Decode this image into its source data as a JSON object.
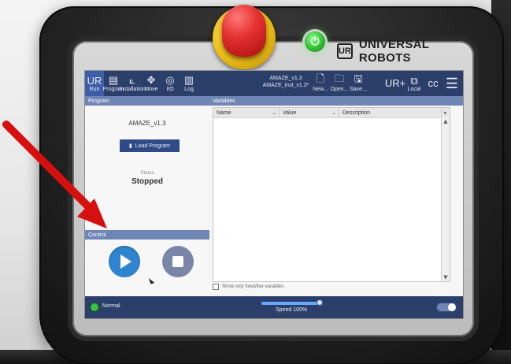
{
  "hardware": {
    "brand": {
      "logo": "UR",
      "name": "UNIVERSAL ROBOTS"
    },
    "power_symbol": "⏻"
  },
  "screen": {
    "topbar": {
      "tabs": [
        {
          "key": "run",
          "label": "Run",
          "icon": "ur-logo-icon"
        },
        {
          "key": "program",
          "label": "Program",
          "icon": "program-icon"
        },
        {
          "key": "installation",
          "label": "Installation",
          "icon": "installation-icon"
        },
        {
          "key": "move",
          "label": "Move",
          "icon": "move-icon"
        },
        {
          "key": "io",
          "label": "I/O",
          "icon": "io-icon"
        },
        {
          "key": "log",
          "label": "Log",
          "icon": "log-icon"
        }
      ],
      "file": {
        "program_file": "AMAZE_v1.3",
        "installation_file": "AMAZE_inst_v1.3*"
      },
      "file_actions": [
        {
          "key": "new",
          "label": "New..."
        },
        {
          "key": "open",
          "label": "Open..."
        },
        {
          "key": "save",
          "label": "Save..."
        }
      ],
      "right_tools": [
        {
          "key": "ur-plus",
          "label": "",
          "icon": "ur-plus-icon"
        },
        {
          "key": "local",
          "label": "Local",
          "icon": "local-icon"
        },
        {
          "key": "cc",
          "label": "",
          "icon": "cc-icon"
        }
      ]
    },
    "left_panel": {
      "header": "Program",
      "program_name": "AMAZE_v1.3",
      "load_button": "Load Program",
      "status_label": "Status",
      "status_value": "Stopped"
    },
    "control_panel": {
      "header": "Control"
    },
    "variables_panel": {
      "header": "Variables",
      "columns": {
        "name": "Name",
        "value": "Value",
        "description": "Description"
      },
      "show_fixed_label": "Show only fixed/live variables"
    },
    "footer": {
      "status": "Normal",
      "speed_label": "Speed 100%",
      "speed_percent": 100
    }
  },
  "colors": {
    "topbar": "#2b3f6a",
    "accent_blue": "#2f84cf",
    "ok_green": "#36c14a",
    "annotation_red": "#d60f0f"
  }
}
